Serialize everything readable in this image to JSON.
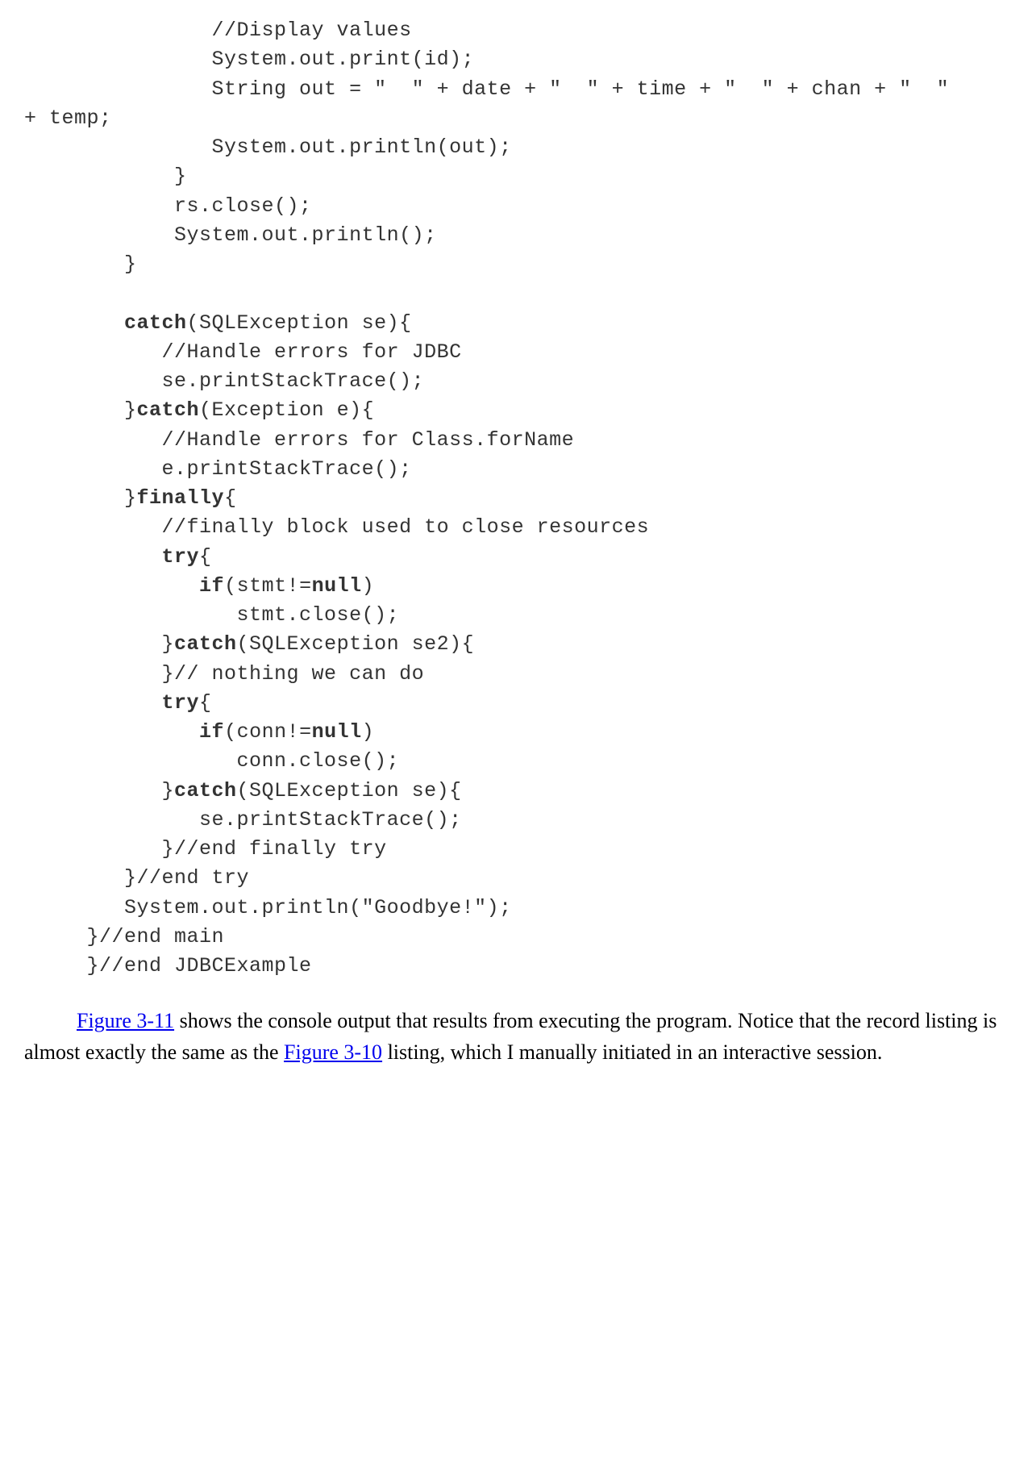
{
  "code": {
    "line1": "               //Display values",
    "line2": "               System.out.print(id);",
    "line3": "               String out = \"  \" + date + \"  \" + time + \"  \" + chan + \"  \"",
    "line4": "+ temp;",
    "line5": "               System.out.println(out);",
    "line6": "            }",
    "line7": "            rs.close();",
    "line8": "            System.out.println();",
    "line9": "        }",
    "line10": "",
    "catch1a": "        ",
    "catch1b": "catch",
    "catch1c": "(SQLException se){",
    "line12": "           //Handle errors for JDBC",
    "line13": "           se.printStackTrace();",
    "catch2a": "        }",
    "catch2b": "catch",
    "catch2c": "(Exception e){",
    "line15": "           //Handle errors for Class.forName",
    "line16": "           e.printStackTrace();",
    "finallya": "        }",
    "finallyb": "finally",
    "finallyc": "{",
    "line18": "           //finally block used to close resources",
    "try1a": "           ",
    "try1b": "try",
    "try1c": "{",
    "if1a": "              ",
    "if1b": "if",
    "if1c": "(stmt!=",
    "if1d": "null",
    "if1e": ")",
    "line21": "                 stmt.close();",
    "catch3a": "           }",
    "catch3b": "catch",
    "catch3c": "(SQLException se2){",
    "line23": "           }// nothing we can do",
    "try2a": "           ",
    "try2b": "try",
    "try2c": "{",
    "if2a": "              ",
    "if2b": "if",
    "if2c": "(conn!=",
    "if2d": "null",
    "if2e": ")",
    "line26": "                 conn.close();",
    "catch4a": "           }",
    "catch4b": "catch",
    "catch4c": "(SQLException se){",
    "line28": "              se.printStackTrace();",
    "line29": "           }//end finally try",
    "line30": "        }//end try",
    "line31": "        System.out.println(\"Goodbye!\");",
    "line32": "     }//end main",
    "line33": "     }//end JDBCExample"
  },
  "paragraph": {
    "link1": "Figure 3-11",
    "text1": " shows the console output that results from executing the program. Notice that the record listing is almost exactly the same as the ",
    "link2": "Figure 3-10",
    "text2": " listing, which I manually initiated in an interactive session."
  }
}
